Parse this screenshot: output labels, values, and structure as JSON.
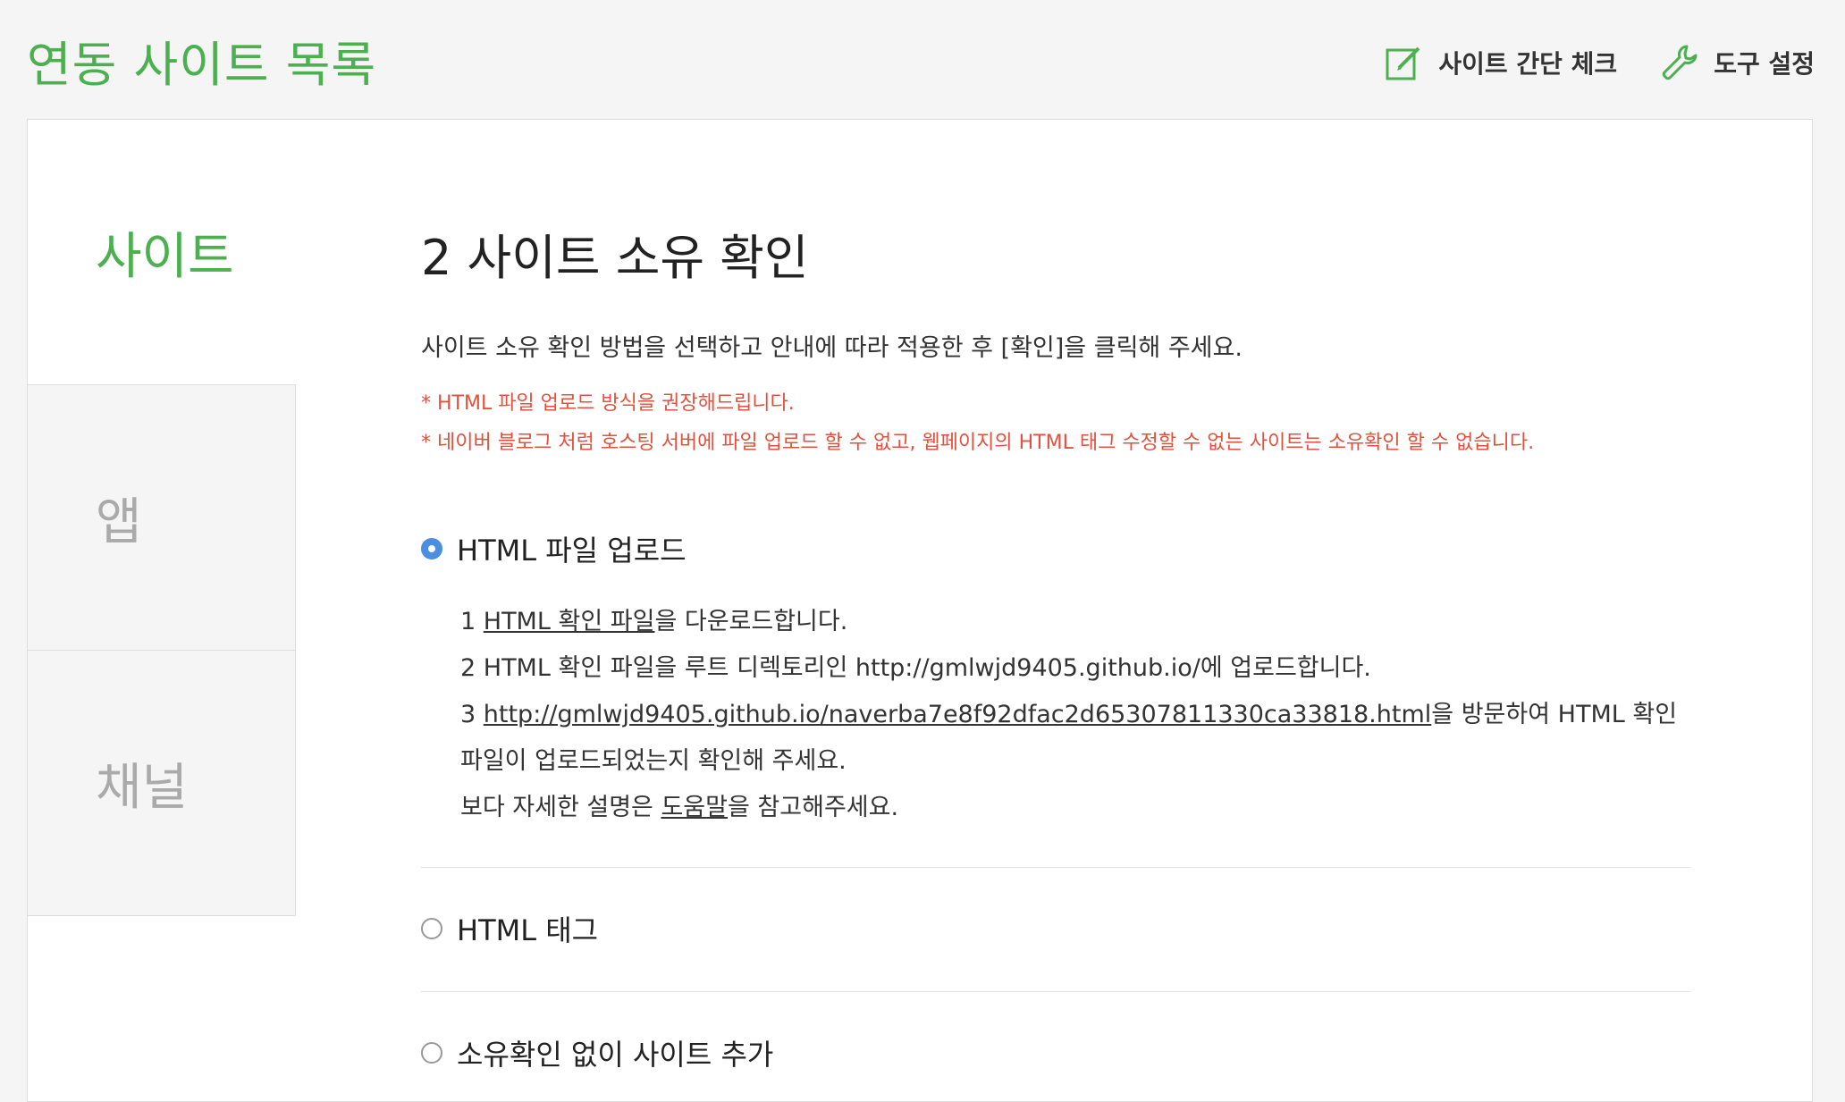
{
  "header": {
    "title": "연동 사이트 목록",
    "tools": [
      {
        "label": "사이트 간단 체크",
        "icon": "edit-check-icon"
      },
      {
        "label": "도구 설정",
        "icon": "wrench-icon"
      }
    ]
  },
  "sidebar": {
    "items": [
      {
        "label": "사이트",
        "active": true
      },
      {
        "label": "앱",
        "active": false
      },
      {
        "label": "채널",
        "active": false
      }
    ]
  },
  "main": {
    "step_title": "2 사이트 소유 확인",
    "intro": "사이트 소유 확인 방법을 선택하고 안내에 따라 적용한 후 [확인]을 클릭해 주세요.",
    "notes": [
      "* HTML 파일 업로드 방식을 권장해드립니다.",
      "* 네이버 블로그 처럼 호스팅 서버에 파일 업로드 할 수 없고, 웹페이지의 HTML 태그 수정할 수 없는 사이트는 소유확인 할 수 없습니다."
    ],
    "options": [
      {
        "label": "HTML 파일 업로드",
        "selected": true,
        "steps": {
          "s1_num": "1 ",
          "s1_link": "HTML 확인 파일",
          "s1_rest": "을 다운로드합니다.",
          "s2": "2 HTML 확인 파일을 루트 디렉토리인 http://gmlwjd9405.github.io/에 업로드합니다.",
          "s3_num": "3 ",
          "s3_link": "http://gmlwjd9405.github.io/naverba7e8f92dfac2d65307811330ca33818.html",
          "s3_rest": "을 방문하여 HTML 확인 파일이 업로드되었는지 확인해 주세요.",
          "help_pre": "보다 자세한 설명은 ",
          "help_link": "도움말",
          "help_post": "을 참고해주세요."
        }
      },
      {
        "label": "HTML 태그",
        "selected": false
      },
      {
        "label": "소유확인 없이 사이트 추가",
        "selected": false
      }
    ]
  },
  "colors": {
    "brand_green": "#4caf50",
    "warning_red": "#e0523f",
    "radio_blue": "#4a8fe0"
  }
}
